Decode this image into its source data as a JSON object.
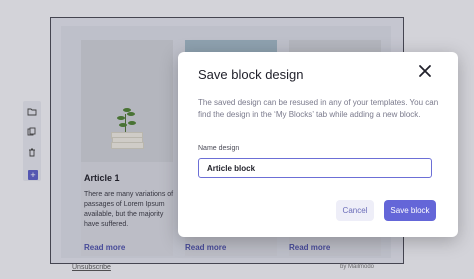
{
  "colors": {
    "accent": "#6466d8",
    "link": "#4d51a8"
  },
  "cards": [
    {
      "title": "Article 1",
      "text": "There are many variations of passages of Lorem Ipsum available, but the majority have suffered.",
      "link": "Read more"
    },
    {
      "title": "",
      "text": "",
      "link": "Read more"
    },
    {
      "title": "",
      "text": "",
      "link": "Read more"
    }
  ],
  "footer": {
    "unsubscribe": "Unsubscribe",
    "brand": "by Mailmodo"
  },
  "tools": {
    "add_label": "+"
  },
  "modal": {
    "title": "Save block design",
    "description": "The saved design can be resused in any of your templates. You can find the design in the ‘My Blocks’ tab while adding a new block.",
    "field_label": "Name design",
    "input_value": "Article block",
    "cancel_label": "Cancel",
    "save_label": "Save block"
  }
}
